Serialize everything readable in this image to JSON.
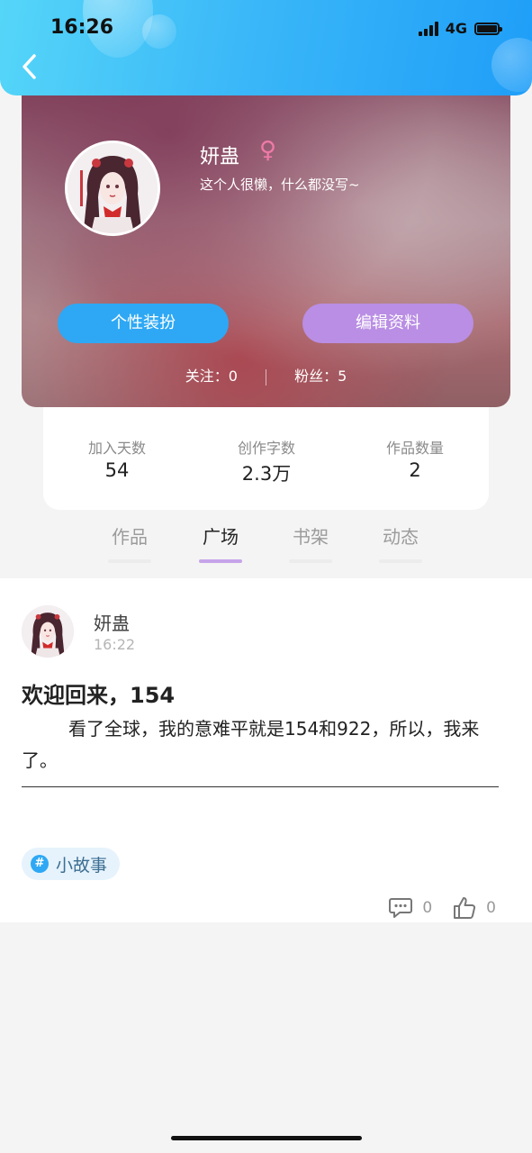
{
  "status_bar": {
    "time": "16:26",
    "network": "4G"
  },
  "profile": {
    "name": "妍蛊",
    "gender_symbol": "♀",
    "bio": "这个人很懒，什么都没写~",
    "dress_button": "个性装扮",
    "edit_button": "编辑资料",
    "following_label": "关注：",
    "following_count": "0",
    "fans_label": "粉丝：",
    "fans_count": "5"
  },
  "stats": [
    {
      "label": "加入天数",
      "value": "54"
    },
    {
      "label": "创作字数",
      "value": "2.3万"
    },
    {
      "label": "作品数量",
      "value": "2"
    }
  ],
  "tabs": [
    {
      "label": "作品"
    },
    {
      "label": "广场"
    },
    {
      "label": "书架"
    },
    {
      "label": "动态"
    }
  ],
  "active_tab": "广场",
  "post": {
    "author": "妍蛊",
    "time": "16:22",
    "title": "欢迎回来，154",
    "body": "看了全球，我的意难平就是154和922，所以，我来了。",
    "tag": "小故事",
    "comment_count": "0",
    "like_count": "0"
  },
  "colors": {
    "header_gradient_start": "#55d6f8",
    "header_gradient_end": "#1f9ef8",
    "dress_button": "#2ea8f4",
    "edit_button": "#b98ee4",
    "active_tab_indicator": "#c6a4ea",
    "gender_icon": "#f07aa6"
  },
  "icons": {
    "back": "chevron-left-icon",
    "gender": "female-icon",
    "comment": "comment-icon",
    "like": "thumbs-up-icon",
    "tag": "hash-icon"
  }
}
